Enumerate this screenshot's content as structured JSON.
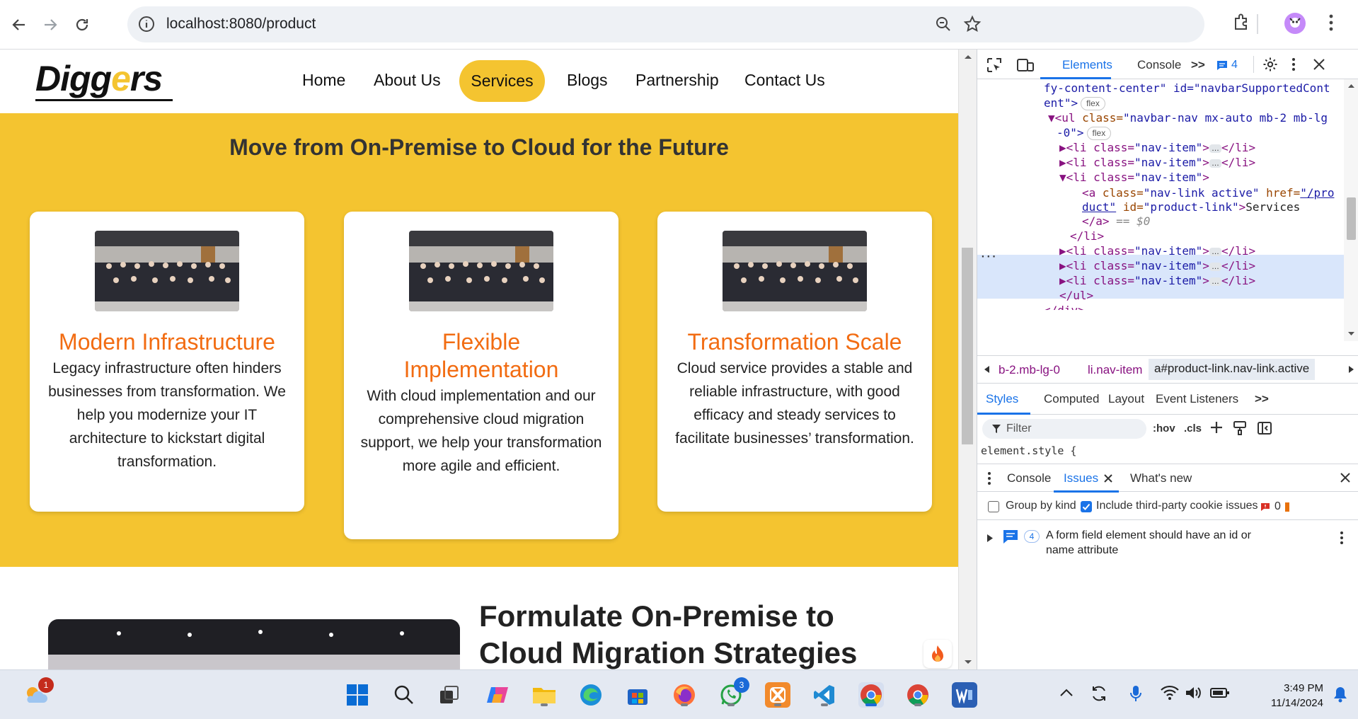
{
  "browser": {
    "url": "localhost:8080/product"
  },
  "site": {
    "logo_pre": "Digg",
    "logo_accent": "e",
    "logo_post": "rs",
    "nav": [
      "Home",
      "About Us",
      "Services",
      "Blogs",
      "Partnership",
      "Contact Us"
    ],
    "active_nav": "Services",
    "section_title": "Move from On-Premise to Cloud for the Future",
    "cards": [
      {
        "title": "Modern Infrastructure",
        "text": "Legacy infrastructure often hinders businesses from transformation. We help you modernize your IT architecture to kickstart digital transformation."
      },
      {
        "title": "Flexible Implementation",
        "text": "With cloud implementation and our comprehensive cloud migration support, we help your transformation more agile and efficient."
      },
      {
        "title": "Transformation Scale",
        "text": "Cloud service provides a stable and reliable infrastructure, with good efficacy and steady services to facilitate businesses’ transformation."
      }
    ],
    "section2_title": "Formulate On-Premise to Cloud Migration Strategies"
  },
  "devtools": {
    "tabs": [
      "Elements",
      "Console"
    ],
    "active_tab": "Elements",
    "message_count": "4",
    "dom_lines": {
      "l1": "fy-content-center\" id=\"navbarSupportedCont",
      "l2": "ent\">",
      "flex_badge": "flex",
      "ul_open_class": "navbar-nav mx-auto mb-2 mb-lg",
      "ul_open_cont": "-0\">",
      "li_tag": "<li class=",
      "li_class": "\"nav-item\"",
      "li_close": "</li>",
      "a_class": "\"nav-link active\"",
      "a_href_1": "\"/pro",
      "a_href_2": "duct\"",
      "a_id": "\"product-link\"",
      "a_text": "Services",
      "a_close": "</a>",
      "eq_sel": "== $0",
      "ul_close": "</ul>",
      "div_close": "</div>"
    },
    "breadcrumbs": [
      "b-2.mb-lg-0",
      "li.nav-item",
      "a#product-link.nav-link.active"
    ],
    "styles_tabs": [
      "Styles",
      "Computed",
      "Layout",
      "Event Listeners"
    ],
    "filter_placeholder": "Filter",
    "hov": ":hov",
    "cls": ".cls",
    "element_style": "element.style {",
    "drawer_tabs": [
      "Console",
      "Issues",
      "What's new"
    ],
    "group_by_kind": "Group by kind",
    "include_third_party": "Include third-party cookie issues",
    "issue_error_count": "0",
    "issue_count": "4",
    "issue_text_1": "A form field element should have an id or",
    "issue_text_2": "name attribute"
  },
  "taskbar": {
    "weather_badge": "1",
    "whatsapp_badge": "3",
    "time": "3:49 PM",
    "date": "11/14/2024"
  },
  "colors": {
    "brand_yellow": "#f4c430",
    "card_title_orange": "#f26c12",
    "devtools_blue": "#1a73e8"
  }
}
